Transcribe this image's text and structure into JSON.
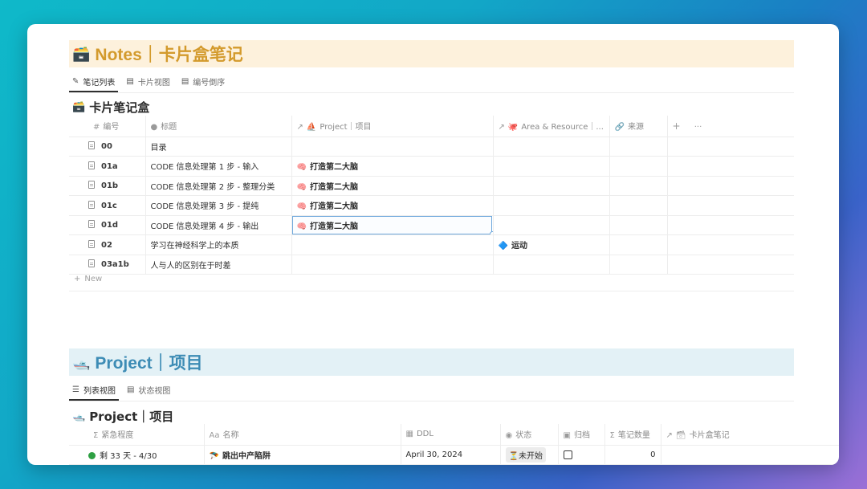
{
  "notes": {
    "banner_emoji": "🗃️",
    "banner_title": "Notes｜卡片盒笔记",
    "tabs": [
      {
        "icon": "✎",
        "label": "笔记列表"
      },
      {
        "icon": "▤",
        "label": "卡片视图"
      },
      {
        "icon": "▤",
        "label": "编号倒序"
      }
    ],
    "section_emoji": "🗃️",
    "section_title": "卡片笔记盒",
    "columns": {
      "id": "编号",
      "title": "标题",
      "project": "Project｜项目",
      "area": "Area & Resource｜...",
      "source": "来源",
      "add": "+",
      "more": "···"
    },
    "rows": [
      {
        "id": "00",
        "title": "目录",
        "project": "",
        "area": ""
      },
      {
        "id": "01a",
        "title": "CODE 信息处理第 1 步 - 输入",
        "project": "打造第二大脑",
        "area": ""
      },
      {
        "id": "01b",
        "title": "CODE 信息处理第 2 步 - 整理分类",
        "project": "打造第二大脑",
        "area": ""
      },
      {
        "id": "01c",
        "title": "CODE 信息处理第 3 步 - 提纯",
        "project": "打造第二大脑",
        "area": ""
      },
      {
        "id": "01d",
        "title": "CODE 信息处理第 4 步 - 输出",
        "project": "打造第二大脑",
        "area": ""
      },
      {
        "id": "02",
        "title": "学习在神经科学上的本质",
        "project": "",
        "area": "运动"
      },
      {
        "id": "03a1b",
        "title": "人与人的区别在于时差",
        "project": "",
        "area": ""
      }
    ],
    "project_emoji": "🧠",
    "area_emoji": "🔷",
    "new_label": "New"
  },
  "project": {
    "banner_emoji": "🛥️",
    "banner_title": "Project｜项目",
    "tabs": [
      {
        "icon": "☰",
        "label": "列表视图"
      },
      {
        "icon": "▤",
        "label": "状态视图"
      }
    ],
    "section_emoji": "🛥️",
    "section_title": "Project｜项目",
    "columns": {
      "urgency": "紧急程度",
      "name": "名称",
      "ddl": "DDL",
      "status": "状态",
      "archive": "归档",
      "count": "笔记数量",
      "notes": "卡片盒笔记"
    },
    "rows": [
      {
        "urgency": "剩 33 天 - 4/30",
        "name_emoji": "🪂",
        "name": "跳出中产陷阱",
        "ddl": "April 30, 2024",
        "status_emoji": "⏳",
        "status": "未开始",
        "count": "0"
      }
    ]
  }
}
